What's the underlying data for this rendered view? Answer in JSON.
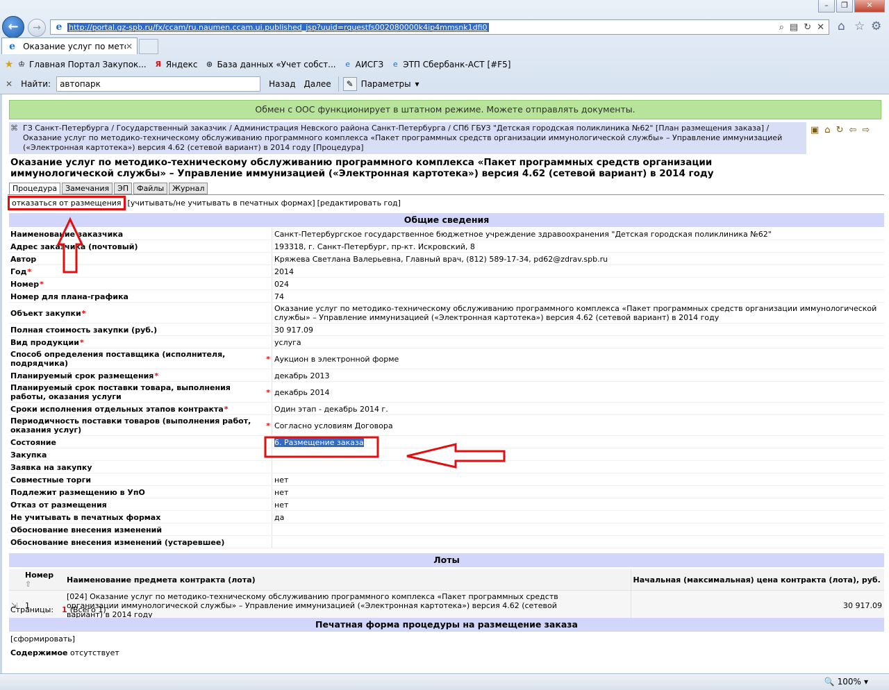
{
  "browser": {
    "url": "http://portal.gz-spb.ru/fx/ccam/ru.naumen.ccam.ui.published_jsp?uuid=rquestfs002080000k4ip4mmsnk1dfi0",
    "tab_title": "Оказание услуг по методи...",
    "favorites": [
      {
        "label": "Главная Портал Закупок...",
        "icon": "emblem-icon"
      },
      {
        "label": "Яндекс",
        "icon": "yandex-icon"
      },
      {
        "label": "База данных «Учет собст...",
        "icon": "db-icon"
      },
      {
        "label": "АИСГЗ",
        "icon": "page-icon"
      },
      {
        "label": "ЭТП Сбербанк-АСТ [#F5]",
        "icon": "page-icon"
      }
    ],
    "find": {
      "label": "Найти:",
      "value": "автопарк",
      "prev": "Назад",
      "next": "Далее",
      "params": "Параметры"
    },
    "zoom": "100%"
  },
  "page": {
    "notice": "Обмен с ООС функционирует в штатном режиме. Можете отправлять документы.",
    "breadcrumb": "ГЗ Санкт-Петербурга / Государственный заказчик / Администрация Невского района Санкт-Петербурга / СПб ГБУЗ \"Детская городская поликлиника №62\" [План размещения заказа] / Оказание услуг по методико-техническому обслуживанию программного комплекса «Пакет программных средств организации иммунологической службы» – Управление иммунизацией («Электронная картотека») версия 4.62 (сетевой вариант) в 2014 году [Процедура]",
    "title": "Оказание услуг по методико-техническому обслуживанию программного комплекса «Пакет программных средств организации иммунологической службы» – Управление иммунизацией («Электронная картотека») версия 4.62 (сетевой вариант) в 2014 году",
    "tabs": [
      "Процедура",
      "Замечания",
      "ЭП",
      "Файлы",
      "Журнал"
    ],
    "actions": {
      "refuse": "отказаться от размещения",
      "print_toggle": "[учитывать/не учитывать в печатных формах]",
      "edit_year": "[редактировать год]"
    },
    "general_header": "Общие сведения",
    "fields": [
      {
        "label": "Наименование заказчика",
        "required": false,
        "value": "Санкт-Петербургское государственное бюджетное учреждение здравоохранения \"Детская городская поликлиника №62\""
      },
      {
        "label": "Адрес заказчика (почтовый)",
        "required": false,
        "value": "193318, г. Санкт-Петербург, пр-кт. Искровский, 8"
      },
      {
        "label": "Автор",
        "required": false,
        "value": "Кряжева Светлана Валерьевна, Главный врач, (812) 589-17-34, pd62@zdrav.spb.ru"
      },
      {
        "label": "Год",
        "required": true,
        "value": "2014"
      },
      {
        "label": "Номер",
        "required": true,
        "value": "024"
      },
      {
        "label": "Номер для плана-графика",
        "required": false,
        "value": "74"
      },
      {
        "label": "Объект закупки",
        "required": true,
        "value": "Оказание услуг по методико-техническому обслуживанию программного комплекса «Пакет программных средств организации иммунологической службы» – Управление иммунизацией («Электронная картотека») версия 4.62 (сетевой вариант) в 2014 году"
      },
      {
        "label": "Полная стоимость закупки (руб.)",
        "required": false,
        "value": "30 917.09"
      },
      {
        "label": "Вид продукции",
        "required": true,
        "value": "услуга"
      },
      {
        "label": "Способ определения поставщика (исполнителя, подрядчика)",
        "required": true,
        "value": "Аукцион в электронной форме"
      },
      {
        "label": "Планируемый срок размещения",
        "required": true,
        "value": "декабрь 2013"
      },
      {
        "label": "Планируемый срок поставки товара, выполнения работы, оказания услуги",
        "required": true,
        "value": "декабрь 2014"
      },
      {
        "label": "Сроки исполнения отдельных этапов контракта",
        "required": true,
        "value": "Один этап - декабрь 2014 г."
      },
      {
        "label": "Периодичность поставки товаров (выполнения работ, оказания услуг)",
        "required": true,
        "value": "Согласно условиям Договора"
      },
      {
        "label": "Состояние",
        "required": false,
        "value": "6. Размещение заказа"
      },
      {
        "label": "Закупка",
        "required": false,
        "value": ""
      },
      {
        "label": "Заявка на закупку",
        "required": false,
        "value": ""
      },
      {
        "label": "Совместные торги",
        "required": false,
        "value": "нет"
      },
      {
        "label": "Подлежит размещению в УпО",
        "required": false,
        "value": "нет"
      },
      {
        "label": "Отказ от размещения",
        "required": false,
        "value": "нет"
      },
      {
        "label": "Не учитывать в печатных формах",
        "required": false,
        "value": "да"
      },
      {
        "label": "Обоснование внесения изменений",
        "required": false,
        "value": ""
      },
      {
        "label": "Обоснование внесения изменений (устаревшее)",
        "required": false,
        "value": ""
      }
    ],
    "lots_header": "Лоты",
    "lots_columns": [
      "Номер",
      "Наименование предмета контракта (лота)",
      "Начальная (максимальная) цена контракта (лота), руб."
    ],
    "lots": [
      {
        "number": "1",
        "name": "[024] Оказание услуг по методико-техническому обслуживанию программного комплекса «Пакет программных средств организации иммунологической службы» – Управление иммунизацией («Электронная картотека») версия 4.62 (сетевой вариант) в 2014 году",
        "price": "30 917.09"
      }
    ],
    "pager": {
      "label": "Страницы:",
      "current": "1",
      "total": "(Всего 1)"
    },
    "print_header": "Печатная форма процедуры на размещение заказа",
    "generate": "[сформировать]",
    "contents_label": "Содержимое",
    "contents_value": "отсутствует"
  },
  "colors": {
    "notice_bg": "#b8e39b",
    "breadcrumb_bg": "#d9def7",
    "section_bg": "#d2d6fa",
    "annotation_red": "#e01010",
    "selection_blue": "#3169c6"
  }
}
